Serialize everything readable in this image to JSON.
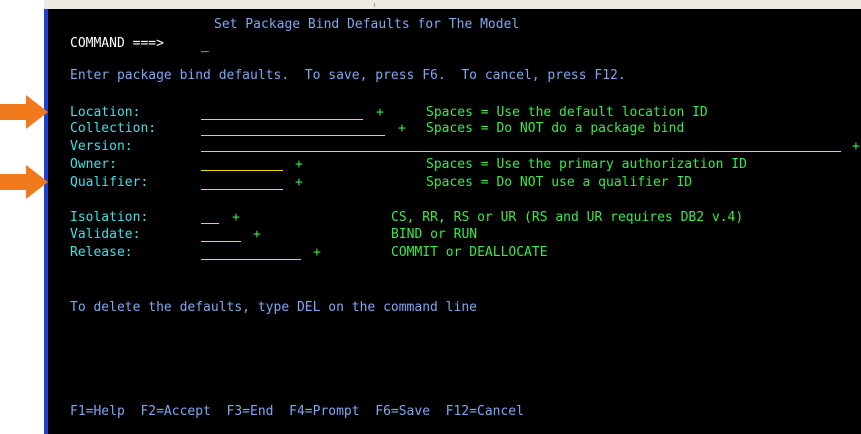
{
  "screen": {
    "title": "Set Package Bind Defaults for The Model",
    "command_label": "COMMAND ===>",
    "command_value": "",
    "cursor": "_",
    "instructions": "Enter package bind defaults.  To save, press F6.  To cancel, press F12.",
    "fields": [
      {
        "label": "Location:",
        "value": "",
        "plus": "+",
        "help": "Spaces = Use the default location ID"
      },
      {
        "label": "Collection:",
        "value": "",
        "plus": "+",
        "help": "Spaces = Do NOT do a package bind"
      },
      {
        "label": "Version:",
        "value": "",
        "plus": "+",
        "help": ""
      },
      {
        "label": "Owner:",
        "value": "",
        "plus": "+",
        "help": "Spaces = Use the primary authorization ID"
      },
      {
        "label": "Qualifier:",
        "value": "",
        "plus": "+",
        "help": "Spaces = Do NOT use a qualifier ID"
      },
      {
        "label": "Isolation:",
        "value": "",
        "plus": "+",
        "help": "CS, RR, RS or UR (RS and UR requires DB2 v.4)"
      },
      {
        "label": "Validate:",
        "value": "",
        "plus": "+",
        "help": "BIND or RUN"
      },
      {
        "label": "Release:",
        "value": "",
        "plus": "+",
        "help": "COMMIT or DEALLOCATE"
      }
    ],
    "delete_note": "To delete the defaults, type DEL on the command line",
    "function_keys": "F1=Help  F2=Accept  F3=End  F4=Prompt  F6=Save  F12=Cancel"
  },
  "annotations": {
    "arrow_color": "#f07a1c",
    "arrow_icon": "arrow-right-icon"
  },
  "colors": {
    "background": "#000000",
    "title": "#7ea7f0",
    "label": "#3fe0e6",
    "help": "#39ea48",
    "input_underline": "#e8e000"
  }
}
